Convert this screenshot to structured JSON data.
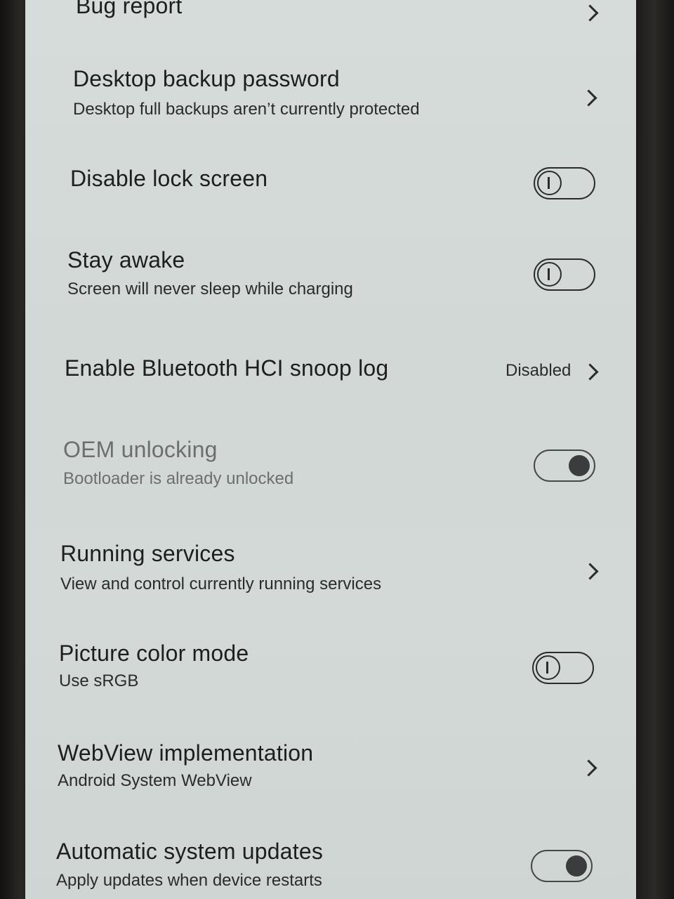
{
  "settings": [
    {
      "title": "Bug report",
      "control": "chevron"
    },
    {
      "title": "Desktop backup password",
      "subtitle": "Desktop full backups aren’t currently protected",
      "control": "chevron"
    },
    {
      "title": "Disable lock screen",
      "control": "toggle",
      "checked": false
    },
    {
      "title": "Stay awake",
      "subtitle": "Screen will never sleep while charging",
      "control": "toggle",
      "checked": false
    },
    {
      "title": "Enable Bluetooth HCI snoop log",
      "value": "Disabled",
      "control": "chevron"
    },
    {
      "title": "OEM unlocking",
      "subtitle": "Bootloader is already unlocked",
      "control": "toggle",
      "checked": true,
      "enabled": false
    },
    {
      "title": "Running services",
      "subtitle": "View and control currently running services",
      "control": "chevron"
    },
    {
      "title": "Picture color mode",
      "subtitle": "Use sRGB",
      "control": "toggle",
      "checked": false
    },
    {
      "title": "WebView implementation",
      "subtitle": "Android System WebView",
      "control": "chevron"
    },
    {
      "title": "Automatic system updates",
      "subtitle": "Apply updates when device restarts",
      "control": "toggle",
      "checked": true
    }
  ]
}
